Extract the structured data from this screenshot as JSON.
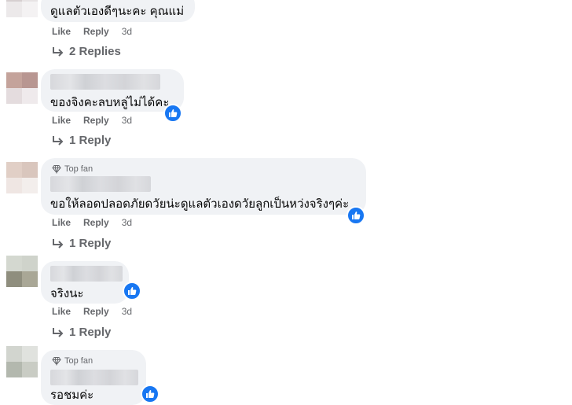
{
  "comments": [
    {
      "text": "ดูแลตัวเองดีๆนะคะ คุณแม่",
      "like_label": "Like",
      "reply_label": "Reply",
      "time": "3d",
      "replies_label": "2 Replies",
      "top_fan": false,
      "reaction": false
    },
    {
      "text": "ของจิงคะลบหลู่ไม่ได้คะ",
      "like_label": "Like",
      "reply_label": "Reply",
      "time": "3d",
      "replies_label": "1 Reply",
      "top_fan": false,
      "reaction": "like"
    },
    {
      "top_fan_label": "Top fan",
      "text": "ขอให้ลอดปลอดภัยดวัยน่ะดูแลตัวเองดวัยลูกเป็นหว่งจริงๆค่ะ",
      "like_label": "Like",
      "reply_label": "Reply",
      "time": "3d",
      "replies_label": "1 Reply",
      "top_fan": true,
      "reaction": "like"
    },
    {
      "text": "จริงนะ",
      "like_label": "Like",
      "reply_label": "Reply",
      "time": "3d",
      "replies_label": "1 Reply",
      "top_fan": false,
      "reaction": "like"
    },
    {
      "top_fan_label": "Top fan",
      "text": "รอชมค่ะ",
      "top_fan": true,
      "reaction": "like"
    }
  ],
  "colors": {
    "bubble": "#f0f2f5",
    "secondary_text": "#65676b",
    "like_blue": "#1877f2"
  },
  "icons": {
    "reply_arrow": "reply-arrow-icon",
    "top_fan": "diamond-icon",
    "reaction": "thumbs-up-icon"
  }
}
